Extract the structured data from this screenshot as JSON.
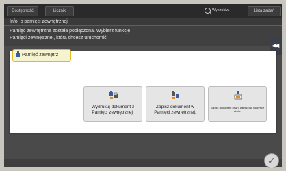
{
  "topbar": {
    "availability": "Dostępność",
    "counter": "Licznik",
    "search": "Wyszukiw.",
    "job_list": "Lista zadań"
  },
  "window": {
    "title": "Info. o pamięci zewnętrznej"
  },
  "message": {
    "line1": "Pamięć zewnętrzna została podłączona. Wybierz funkcję",
    "line2": "Pamięci zewnętrznej, którą chcesz uruchomić."
  },
  "tab": {
    "label": "Pamięć zewnętrz"
  },
  "functions": [
    {
      "label": "Wydrukuj dokument z Pamięci zewnętrznej.",
      "icon": "print-from-memory-icon"
    },
    {
      "label": "Zapisz dokument w Pamięci zewnętrznej.",
      "icon": "save-to-memory-icon"
    },
    {
      "label": "Zapisz dokument zewn. pamięci w Skrzynce użytk.",
      "icon": "save-to-box-icon"
    }
  ],
  "colors": {
    "accent": "#e3b72b",
    "icon_blue": "#3b5e9a",
    "icon_orange": "#e08a2a"
  }
}
